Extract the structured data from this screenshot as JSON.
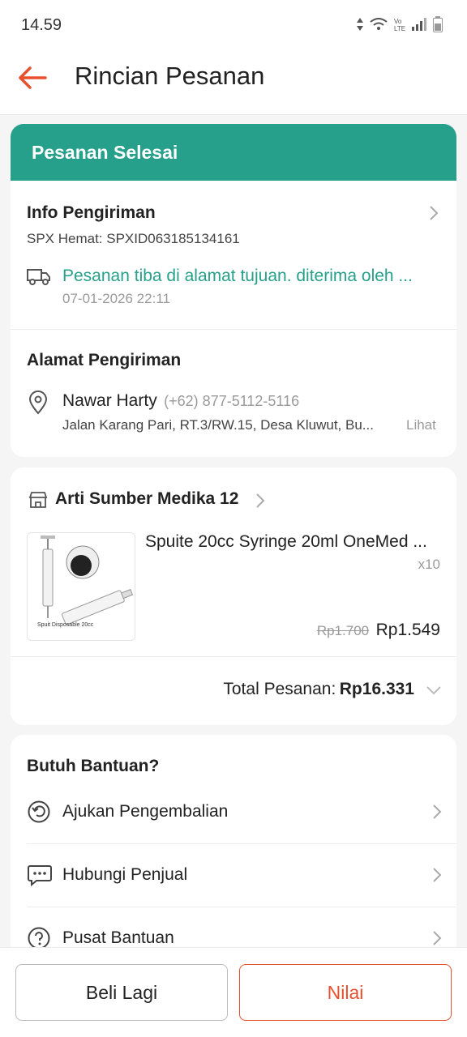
{
  "status_bar": {
    "time": "14.59"
  },
  "header": {
    "title": "Rincian Pesanan"
  },
  "order_status": {
    "label": "Pesanan Selesai"
  },
  "shipping_info": {
    "title": "Info Pengiriman",
    "courier": "SPX Hemat: SPXID063185134161",
    "tracking_text": "Pesanan tiba di alamat tujuan. diterima oleh ...",
    "tracking_time": "07-01-2026 22:11"
  },
  "address": {
    "title": "Alamat Pengiriman",
    "name": "Nawar Harty",
    "phone": "(+62) 877-5112-5116",
    "detail": "Jalan Karang Pari, RT.3/RW.15, Desa Kluwut, Bu...",
    "see_more": "Lihat"
  },
  "shop": {
    "name": "Arti Sumber Medika 12"
  },
  "product": {
    "name": "Spuite 20cc Syringe 20ml OneMed ...",
    "quantity": "x10",
    "original_price": "Rp1.700",
    "price": "Rp1.549",
    "image_caption": "Spuit Disposable 20cc"
  },
  "order_total": {
    "label": "Total Pesanan:",
    "value": "Rp16.331"
  },
  "help": {
    "title": "Butuh Bantuan?",
    "items": [
      {
        "label": "Ajukan Pengembalian",
        "icon": "return-icon"
      },
      {
        "label": "Hubungi Penjual",
        "icon": "chat-icon"
      },
      {
        "label": "Pusat Bantuan",
        "icon": "question-icon"
      }
    ]
  },
  "actions": {
    "buy_again": "Beli Lagi",
    "rate": "Nilai"
  },
  "colors": {
    "accent": "#e8502e",
    "status_green": "#26a08a"
  }
}
